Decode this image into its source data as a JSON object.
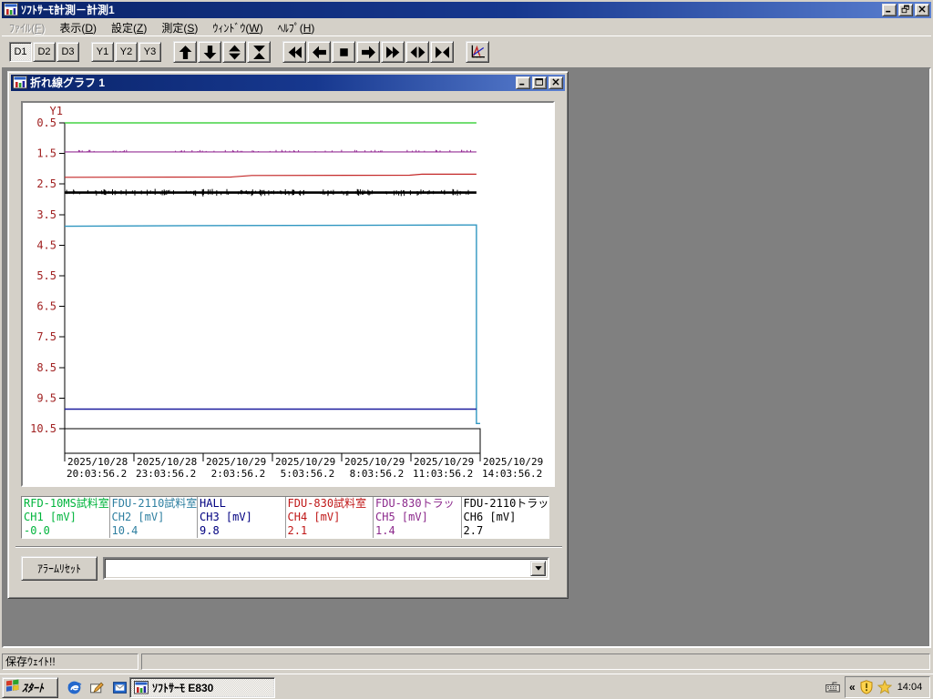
{
  "app": {
    "title": "ｿﾌﾄｻｰﾓ計測－計測1",
    "window_buttons": [
      "minimize-icon",
      "restore-icon",
      "close-icon"
    ]
  },
  "menu_bar": {
    "items": [
      {
        "label": "ﾌｧｲﾙ(F)",
        "disabled": true
      },
      {
        "label": "表示(D)",
        "disabled": false
      },
      {
        "label": "設定(Z)",
        "disabled": false
      },
      {
        "label": "測定(S)",
        "disabled": false
      },
      {
        "label": "ｳｨﾝﾄﾞｳ(W)",
        "disabled": false
      },
      {
        "label": "ﾍﾙﾌﾟ(H)",
        "disabled": false
      }
    ]
  },
  "toolbar": {
    "d_buttons": [
      {
        "label": "D1",
        "pressed": true
      },
      {
        "label": "D2",
        "pressed": false
      },
      {
        "label": "D3",
        "pressed": false
      }
    ],
    "y_buttons": [
      {
        "label": "Y1",
        "pressed": false
      },
      {
        "label": "Y2",
        "pressed": false
      },
      {
        "label": "Y3",
        "pressed": false
      }
    ],
    "nav_group1": [
      "scroll-up-icon",
      "scroll-down-icon",
      "expand-vertical-icon",
      "compress-vertical-icon"
    ],
    "nav_group2": [
      "fast-rewind-icon",
      "step-left-icon",
      "stop-icon",
      "step-right-icon",
      "fast-forward-icon",
      "expand-horizontal-icon",
      "compress-horizontal-icon"
    ],
    "chart_button_icon": "graph-settings-icon"
  },
  "graph_window": {
    "title": "折れ線グラフ 1",
    "window_buttons": [
      "minimize-icon",
      "maximize-icon",
      "close-icon"
    ]
  },
  "chart_data": {
    "type": "line",
    "y_axis": {
      "label": "Y1",
      "min": 0.5,
      "max": 10.5,
      "step": 1.0,
      "increases_downward": true,
      "tick_labels": [
        "0.5",
        "1.5",
        "2.5",
        "3.5",
        "4.5",
        "5.5",
        "6.5",
        "7.5",
        "8.5",
        "9.5",
        "10.5"
      ],
      "label_color": "#a02020"
    },
    "x_axis": {
      "ticks": [
        {
          "date": "2025/10/28",
          "time": "20:03:56.2"
        },
        {
          "date": "2025/10/28",
          "time": "23:03:56.2"
        },
        {
          "date": "2025/10/29",
          "time": " 2:03:56.2"
        },
        {
          "date": "2025/10/29",
          "time": " 5:03:56.2"
        },
        {
          "date": "2025/10/29",
          "time": " 8:03:56.2"
        },
        {
          "date": "2025/10/29",
          "time": "11:03:56.2"
        },
        {
          "date": "2025/10/29",
          "time": "14:03:56.2"
        }
      ]
    },
    "series": [
      {
        "name": "RFD-10MS試料室",
        "channel": "CH1",
        "unit": "mV",
        "current": "-0.0",
        "color": "#44d444",
        "width": 1.4,
        "noise": 0,
        "points": [
          [
            0,
            0.5
          ],
          [
            0.991,
            0.5
          ]
        ]
      },
      {
        "name": "FDU-830トラッ",
        "channel": "CH5",
        "unit": "mV",
        "current": "1.4",
        "color": "#952d95",
        "width": 1.1,
        "noise": 1,
        "points": [
          [
            0,
            1.45
          ],
          [
            0.991,
            1.45
          ]
        ]
      },
      {
        "name": "FDU-830試料室",
        "channel": "CH4",
        "unit": "mV",
        "current": "2.1",
        "color": "#c42828",
        "width": 1.2,
        "noise": 0,
        "points": [
          [
            0,
            2.28
          ],
          [
            0.4,
            2.27
          ],
          [
            0.45,
            2.22
          ],
          [
            0.83,
            2.21
          ],
          [
            0.86,
            2.18
          ],
          [
            0.991,
            2.18
          ]
        ]
      },
      {
        "name": "FDU-2110トラッ",
        "channel": "CH6",
        "unit": "mV",
        "current": "2.7",
        "color": "#000000",
        "width": 2.6,
        "noise": 2,
        "points": [
          [
            0,
            2.78
          ],
          [
            0.991,
            2.78
          ]
        ]
      },
      {
        "name": "FDU-2110試料室",
        "channel": "CH2",
        "unit": "mV",
        "current": "10.4",
        "color": "#2f96c0",
        "width": 1.4,
        "noise": 0,
        "points": [
          [
            0,
            3.88
          ],
          [
            0.3,
            3.86
          ],
          [
            0.991,
            3.84
          ],
          [
            0.991,
            10.33
          ],
          [
            1.0,
            10.33
          ]
        ]
      },
      {
        "name": "HALL",
        "channel": "CH3",
        "unit": "mV",
        "current": "9.8",
        "color": "#1c1c9e",
        "width": 1.4,
        "noise": 0,
        "points": [
          [
            0,
            9.86
          ],
          [
            0.991,
            9.86
          ]
        ]
      }
    ],
    "alarm_strip": {
      "x0": 0,
      "x1": 1.0,
      "y_top": 10.5
    }
  },
  "legend": {
    "channels": [
      {
        "name": "RFD-10MS試料室",
        "channel": "CH1 [mV]",
        "value": "-0.0",
        "color": "#00b43c"
      },
      {
        "name": "FDU-2110試料室",
        "channel": "CH2 [mV]",
        "value": "10.4",
        "color": "#2e7fa0"
      },
      {
        "name": "HALL",
        "channel": "CH3 [mV]",
        "value": "9.8",
        "color": "#000080"
      },
      {
        "name": "FDU-830試料室",
        "channel": "CH4 [mV]",
        "value": "2.1",
        "color": "#c01818"
      },
      {
        "name": "FDU-830トラッ",
        "channel": "CH5 [mV]",
        "value": "1.4",
        "color": "#8c2a8c"
      },
      {
        "name": "FDU-2110トラッ",
        "channel": "CH6 [mV]",
        "value": "2.7",
        "color": "#000000"
      }
    ]
  },
  "alarm_bar": {
    "reset_label": "ｱﾗｰﾑﾘｾｯﾄ",
    "combo_value": ""
  },
  "status_bar": {
    "message": "保存ｳｪｲﾄ!!"
  },
  "taskbar": {
    "start_label": "ｽﾀｰﾄ",
    "quick_launch": [
      "ie-icon",
      "show-desktop-icon",
      "outlook-icon"
    ],
    "task_button": {
      "label": "ｿﾌﾄｻｰﾓ  E830",
      "active": true
    },
    "tray": {
      "chevron": "«",
      "icons": [
        "security-shield-icon",
        "star-icon"
      ],
      "clock": "14:04"
    }
  }
}
